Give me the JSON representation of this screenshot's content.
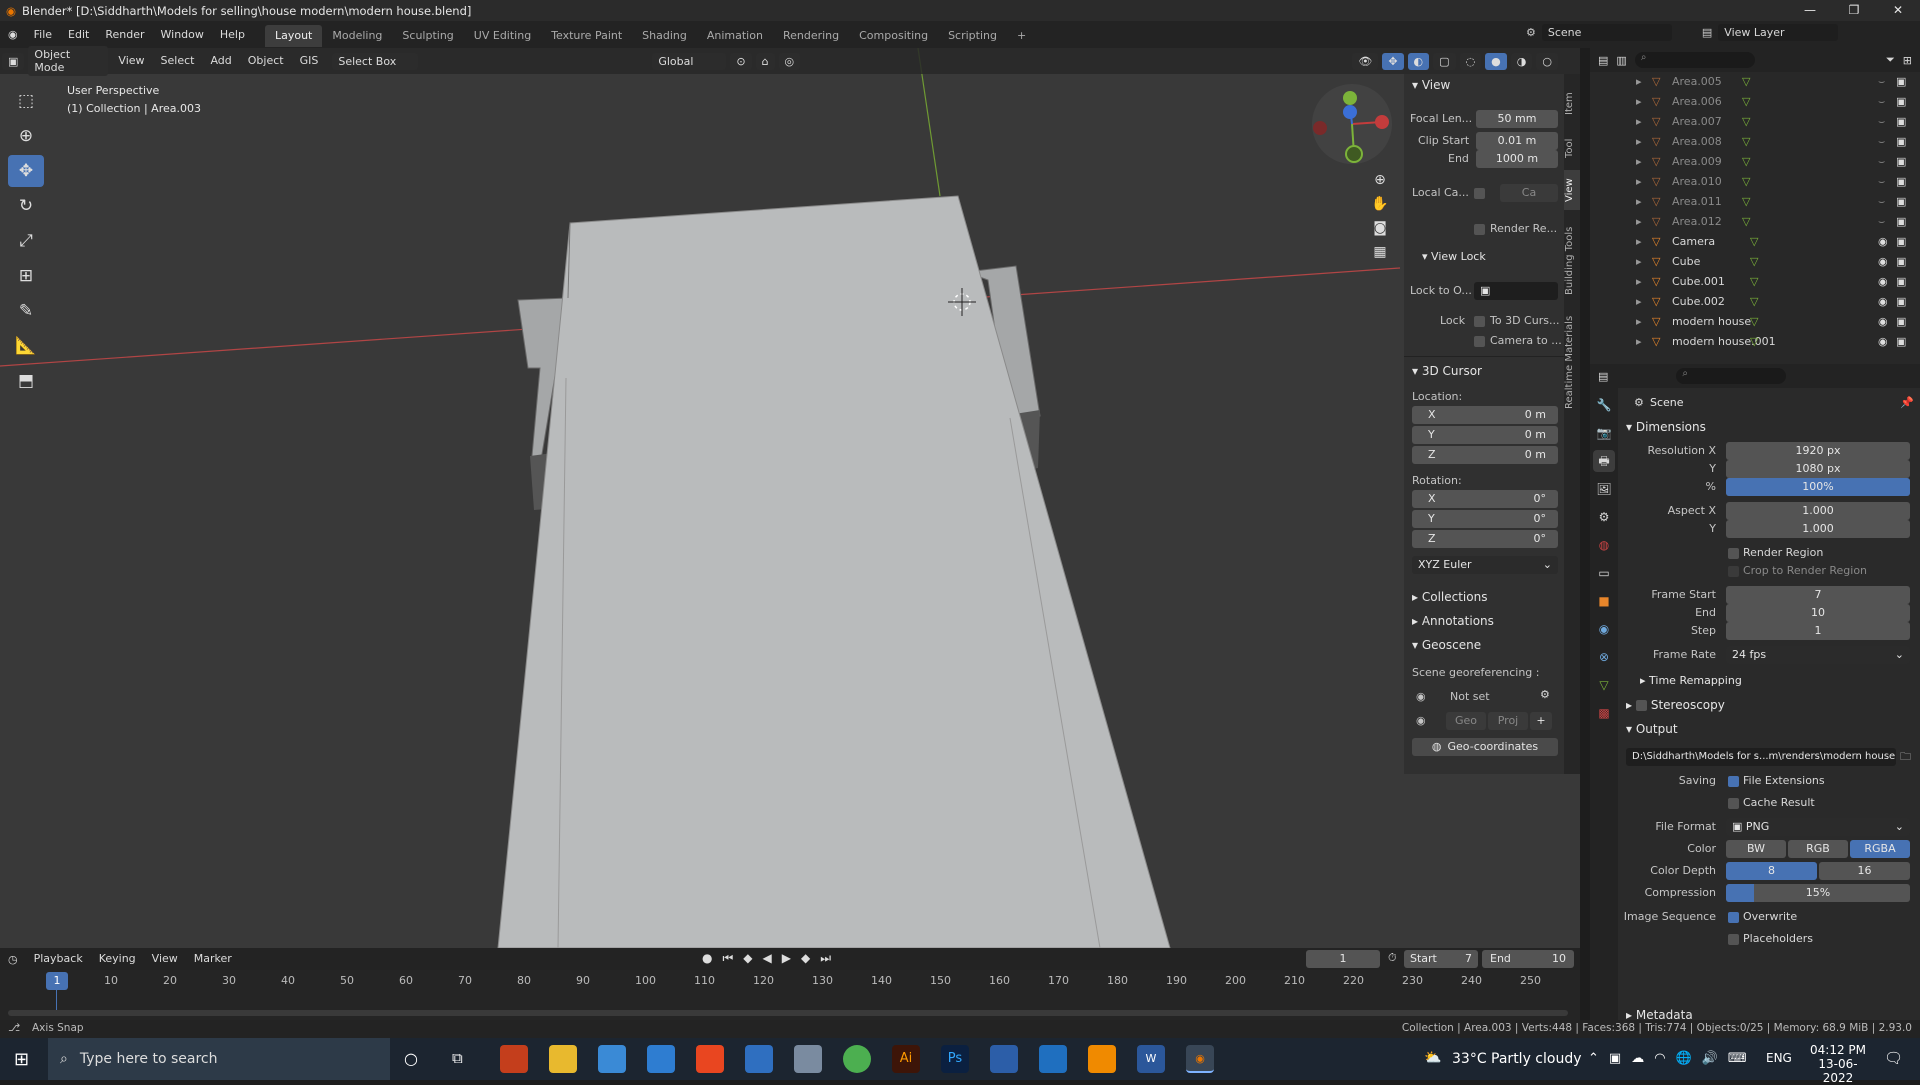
{
  "window": {
    "title": "Blender* [D:\\Siddharth\\Models for selling\\house modern\\modern house.blend]"
  },
  "menu": [
    "File",
    "Edit",
    "Render",
    "Window",
    "Help"
  ],
  "workspaces": [
    "Layout",
    "Modeling",
    "Sculpting",
    "UV Editing",
    "Texture Paint",
    "Shading",
    "Animation",
    "Rendering",
    "Compositing",
    "Scripting"
  ],
  "scene_label": "Scene",
  "view_layer_label": "View Layer",
  "viewport": {
    "mode": "Object Mode",
    "menus": [
      "View",
      "Select",
      "Add",
      "Object",
      "GIS"
    ],
    "select_box": "Select Box",
    "transform": "Global",
    "perspective": "User Perspective",
    "collection_info": "(1) Collection | Area.003"
  },
  "npanel": {
    "view_header": "View",
    "focal_label": "Focal Len...",
    "focal_value": "50 mm",
    "clip_start_label": "Clip Start",
    "clip_start_value": "0.01 m",
    "end_label": "End",
    "end_value": "1000 m",
    "local_camera_label": "Local Ca...",
    "local_camera_value": "Ca",
    "render_region_label": "Render Re...",
    "view_lock_header": "View Lock",
    "lock_to_object_label": "Lock to O...",
    "lock_label": "Lock",
    "to_3d_cursor": "To 3D Curs...",
    "camera_to": "Camera to ...",
    "cursor_header": "3D Cursor",
    "location_label": "Location:",
    "rotation_label": "Rotation:",
    "x": "X",
    "y": "Y",
    "z": "Z",
    "loc_x": "0 m",
    "loc_y": "0 m",
    "loc_z": "0 m",
    "rot_x": "0°",
    "rot_y": "0°",
    "rot_z": "0°",
    "rotation_mode": "XYZ Euler",
    "collections": "Collections",
    "annotations": "Annotations",
    "geoscene": "Geoscene",
    "georef_label": "Scene georeferencing :",
    "not_set": "Not set",
    "geo_btn": "Geo",
    "proj_btn": "Proj",
    "geo_coordinates": "Geo-coordinates",
    "tabs": [
      "Item",
      "Tool",
      "View",
      "Building Tools",
      "Realtime Materials"
    ]
  },
  "outliner": {
    "items": [
      {
        "name": "Area.005",
        "dim": true
      },
      {
        "name": "Area.006",
        "dim": true
      },
      {
        "name": "Area.007",
        "dim": true
      },
      {
        "name": "Area.008",
        "dim": true
      },
      {
        "name": "Area.009",
        "dim": true
      },
      {
        "name": "Area.010",
        "dim": true
      },
      {
        "name": "Area.011",
        "dim": true
      },
      {
        "name": "Area.012",
        "dim": true
      },
      {
        "name": "Camera",
        "dim": false
      },
      {
        "name": "Cube",
        "dim": false
      },
      {
        "name": "Cube.001",
        "dim": false
      },
      {
        "name": "Cube.002",
        "dim": false
      },
      {
        "name": "modern house",
        "dim": false
      },
      {
        "name": "modern house.001",
        "dim": false
      }
    ]
  },
  "properties": {
    "scene_name": "Scene",
    "dimensions": "Dimensions",
    "res_x_label": "Resolution X",
    "res_x": "1920 px",
    "res_y_label": "Y",
    "res_y": "1080 px",
    "pct_label": "%",
    "pct": "100%",
    "pct_fill": 1.0,
    "aspect_x_label": "Aspect X",
    "aspect_x": "1.000",
    "aspect_y_label": "Y",
    "aspect_y": "1.000",
    "render_region": "Render Region",
    "crop_region": "Crop to Render Region",
    "frame_start_label": "Frame Start",
    "frame_start": "7",
    "end_label": "End",
    "frame_end": "10",
    "step_label": "Step",
    "step": "1",
    "frame_rate_label": "Frame Rate",
    "frame_rate": "24 fps",
    "time_remapping": "Time Remapping",
    "stereoscopy": "Stereoscopy",
    "output": "Output",
    "output_path": "D:\\Siddharth\\Models for s...m\\renders\\modern house",
    "saving_label": "Saving",
    "file_extensions": "File Extensions",
    "cache_result": "Cache Result",
    "file_format_label": "File Format",
    "file_format": "PNG",
    "color_label": "Color",
    "color_bw": "BW",
    "color_rgb": "RGB",
    "color_rgba": "RGBA",
    "color_depth_label": "Color Depth",
    "depth_8": "8",
    "depth_16": "16",
    "compression_label": "Compression",
    "compression": "15%",
    "compression_fill": 0.15,
    "image_sequence_label": "Image Sequence",
    "overwrite": "Overwrite",
    "placeholders": "Placeholders",
    "metadata": "Metadata"
  },
  "timeline": {
    "menus": [
      "Playback",
      "Keying",
      "View",
      "Marker"
    ],
    "current_frame": "1",
    "start_label": "Start",
    "start": "7",
    "end_label": "End",
    "end": "10",
    "ticks": [
      "10",
      "20",
      "30",
      "40",
      "50",
      "60",
      "70",
      "80",
      "90",
      "100",
      "110",
      "120",
      "130",
      "140",
      "150",
      "160",
      "170",
      "180",
      "190",
      "200",
      "210",
      "220",
      "230",
      "240",
      "250"
    ],
    "playhead": "1"
  },
  "status": {
    "left": "Axis Snap",
    "right": "Collection | Area.003 | Verts:448 | Faces:368 | Tris:774 | Objects:0/25 | Memory: 68.9 MiB | 2.93.0"
  },
  "taskbar": {
    "search_placeholder": "Type here to search",
    "weather": "33°C  Partly cloudy",
    "lang": "ENG",
    "time": "04:12 PM",
    "date": "13-06-2022"
  },
  "colors": {
    "accent": "#4772b3",
    "x_axis": "#c33c3c",
    "y_axis": "#7cb33a",
    "z_axis": "#3b6fd6"
  }
}
